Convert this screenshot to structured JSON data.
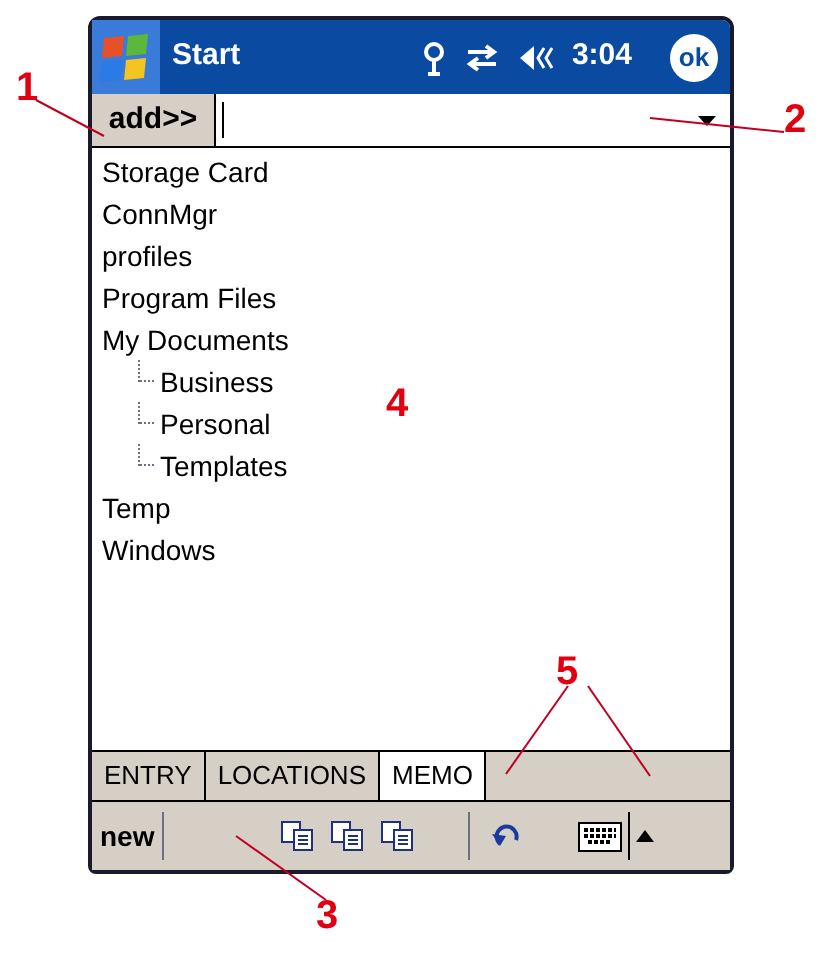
{
  "title_bar": {
    "title": "Start",
    "time": "3:04",
    "ok": "ok"
  },
  "address_bar": {
    "button": "add>>"
  },
  "tree": [
    {
      "label": "Storage Card"
    },
    {
      "label": "ConnMgr"
    },
    {
      "label": "profiles"
    },
    {
      "label": "Program Files"
    },
    {
      "label": "My Documents",
      "children": [
        {
          "label": "Business"
        },
        {
          "label": "Personal"
        },
        {
          "label": "Templates"
        }
      ]
    },
    {
      "label": "Temp"
    },
    {
      "label": "Windows"
    }
  ],
  "tabs": [
    {
      "label": "ENTRY",
      "selected": false
    },
    {
      "label": "LOCATIONS",
      "selected": false
    },
    {
      "label": "MEMO",
      "selected": true
    }
  ],
  "toolbar": {
    "new": "new"
  },
  "callouts": [
    {
      "label": "1"
    },
    {
      "label": "2"
    },
    {
      "label": "3"
    },
    {
      "label": "4"
    },
    {
      "label": "5"
    }
  ]
}
